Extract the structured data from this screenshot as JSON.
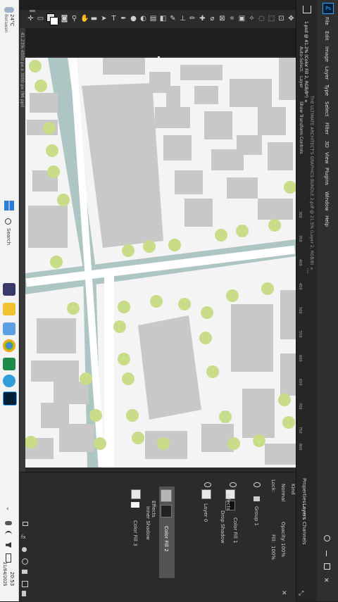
{
  "taskbar": {
    "weather_temp": "24°C",
    "weather_desc": "Berawan",
    "search_label": "Search",
    "time": "20:53",
    "date": "21/04/2025"
  },
  "menubar": {
    "items": [
      "File",
      "Edit",
      "Image",
      "Layer",
      "Type",
      "Select",
      "Filter",
      "3D",
      "View",
      "Plugins",
      "Window",
      "Help"
    ]
  },
  "options_bar": {
    "auto_select": "Auto-Select:",
    "layer_option": "Layer",
    "show_transform": "Show Transform Controls"
  },
  "document": {
    "tab1": "1.psd @ 41.2% (Color Fill 2, RGB/8*) ×",
    "tab2": "THE ULTIMATE ARCHITECT'S GRAPHICS BUNDLE 2.pdf @ 21.5% (Layer 2, RGB/8) ×",
    "status": "41.23%   4500 px x 3000 px (96 ppi)"
  },
  "ruler_ticks": [
    "300",
    "350",
    "400",
    "450",
    "500",
    "550",
    "600",
    "650",
    "700",
    "750",
    "800"
  ],
  "layers_panel": {
    "tabs": [
      "Properties",
      "Layers",
      "Channels"
    ],
    "kind_label": "Kind",
    "blend_mode": "Normal",
    "opacity_label": "Opacity:",
    "opacity_value": "100%",
    "lock_label": "Lock:",
    "fill_label": "Fill:",
    "fill_value": "100%",
    "layers": [
      {
        "name": "Group 1"
      },
      {
        "name": "Color Fill 1"
      },
      {
        "name": "Effects"
      },
      {
        "name": "Drop Shadow"
      },
      {
        "name": "Layer 0"
      },
      {
        "name": "Color Fill 2"
      },
      {
        "name": "Effects"
      },
      {
        "name": "Inner Shadow"
      },
      {
        "name": "Color Fill 3"
      }
    ]
  },
  "colors": {
    "map_bg": "#f4f4f4",
    "building": "#c8c8c8",
    "water": "#aec6c3",
    "tree": "#c9dc88",
    "road": "#fafafa"
  }
}
